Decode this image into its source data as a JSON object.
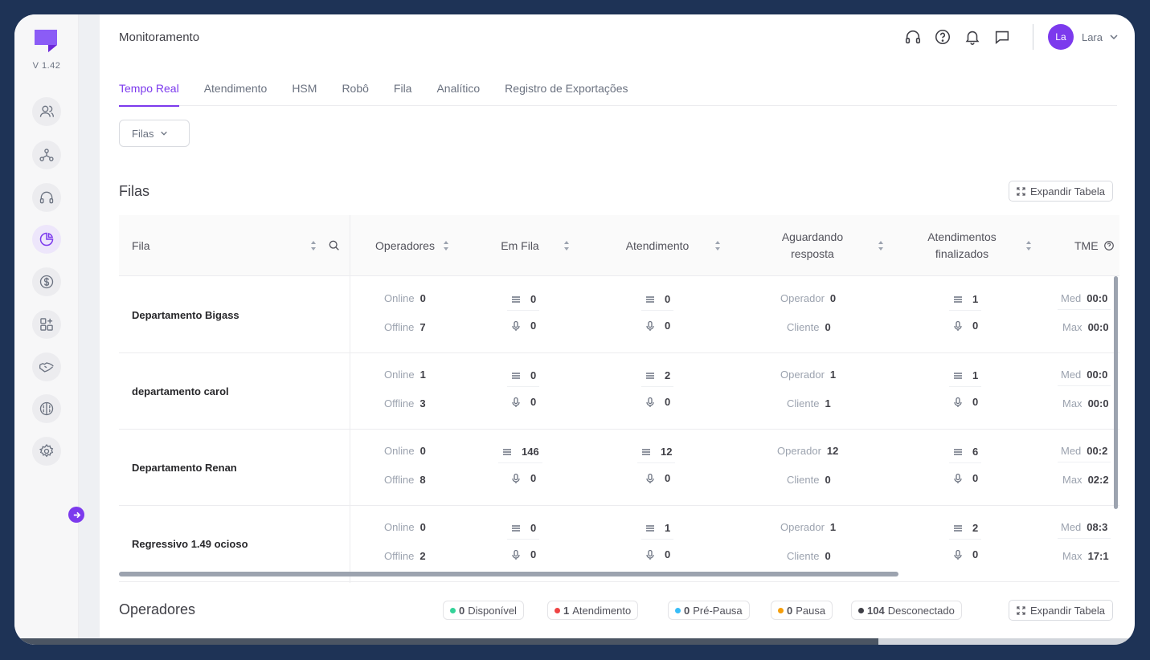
{
  "app": {
    "version": "V 1.42",
    "page_title": "Monitoramento",
    "accent_color": "#7c3aed"
  },
  "sidebar": {
    "items": [
      {
        "icon": "users-icon"
      },
      {
        "icon": "network-icon"
      },
      {
        "icon": "headset-icon"
      },
      {
        "icon": "pie-chart-icon",
        "active": true
      },
      {
        "icon": "dollar-icon"
      },
      {
        "icon": "apps-add-icon"
      },
      {
        "icon": "handshake-icon"
      },
      {
        "icon": "brain-icon"
      },
      {
        "icon": "settings-icon"
      }
    ]
  },
  "header": {
    "user_initials": "La",
    "user_name": "Lara"
  },
  "tabs": [
    {
      "label": "Tempo Real",
      "active": true
    },
    {
      "label": "Atendimento"
    },
    {
      "label": "HSM"
    },
    {
      "label": "Robô"
    },
    {
      "label": "Fila"
    },
    {
      "label": "Analítico"
    },
    {
      "label": "Registro de Exportações"
    }
  ],
  "filter": {
    "label": "Filas"
  },
  "filas_section": {
    "title": "Filas",
    "expand_label": "Expandir Tabela",
    "columns": [
      "Fila",
      "Operadores",
      "Em Fila",
      "Atendimento",
      "Aguardando resposta",
      "Atendimentos finalizados",
      "TME"
    ],
    "labels": {
      "online": "Online",
      "offline": "Offline",
      "operador": "Operador",
      "cliente": "Cliente",
      "med": "Med",
      "max": "Max"
    },
    "rows": [
      {
        "name": "Departamento Bigass",
        "online": "0",
        "offline": "7",
        "fila_q": "0",
        "fila_v": "0",
        "atend_q": "0",
        "atend_v": "0",
        "ag_op": "0",
        "ag_cli": "0",
        "fin_q": "1",
        "fin_v": "0",
        "tme_med": "00:0",
        "tme_max": "00:0"
      },
      {
        "name": "departamento carol",
        "online": "1",
        "offline": "3",
        "fila_q": "0",
        "fila_v": "0",
        "atend_q": "2",
        "atend_v": "0",
        "ag_op": "1",
        "ag_cli": "1",
        "fin_q": "1",
        "fin_v": "0",
        "tme_med": "00:0",
        "tme_max": "00:0"
      },
      {
        "name": "Departamento Renan",
        "online": "0",
        "offline": "8",
        "fila_q": "146",
        "fila_v": "0",
        "atend_q": "12",
        "atend_v": "0",
        "ag_op": "12",
        "ag_cli": "0",
        "fin_q": "6",
        "fin_v": "0",
        "tme_med": "00:2",
        "tme_max": "02:2"
      },
      {
        "name": "Regressivo 1.49 ocioso",
        "online": "0",
        "offline": "2",
        "fila_q": "0",
        "fila_v": "0",
        "atend_q": "1",
        "atend_v": "0",
        "ag_op": "1",
        "ag_cli": "0",
        "fin_q": "2",
        "fin_v": "0",
        "tme_med": "08:3",
        "tme_max": "17:1"
      }
    ]
  },
  "operadores_section": {
    "title": "Operadores",
    "expand_label": "Expandir Tabela",
    "statuses": [
      {
        "count": "0",
        "label": "Disponível",
        "color": "#34d399"
      },
      {
        "count": "1",
        "label": "Atendimento",
        "color": "#ef4444"
      },
      {
        "count": "0",
        "label": "Pré-Pausa",
        "color": "#38bdf8"
      },
      {
        "count": "0",
        "label": "Pausa",
        "color": "#f59e0b"
      },
      {
        "count": "104",
        "label": "Desconectado",
        "color": "#3f3f46"
      }
    ]
  }
}
